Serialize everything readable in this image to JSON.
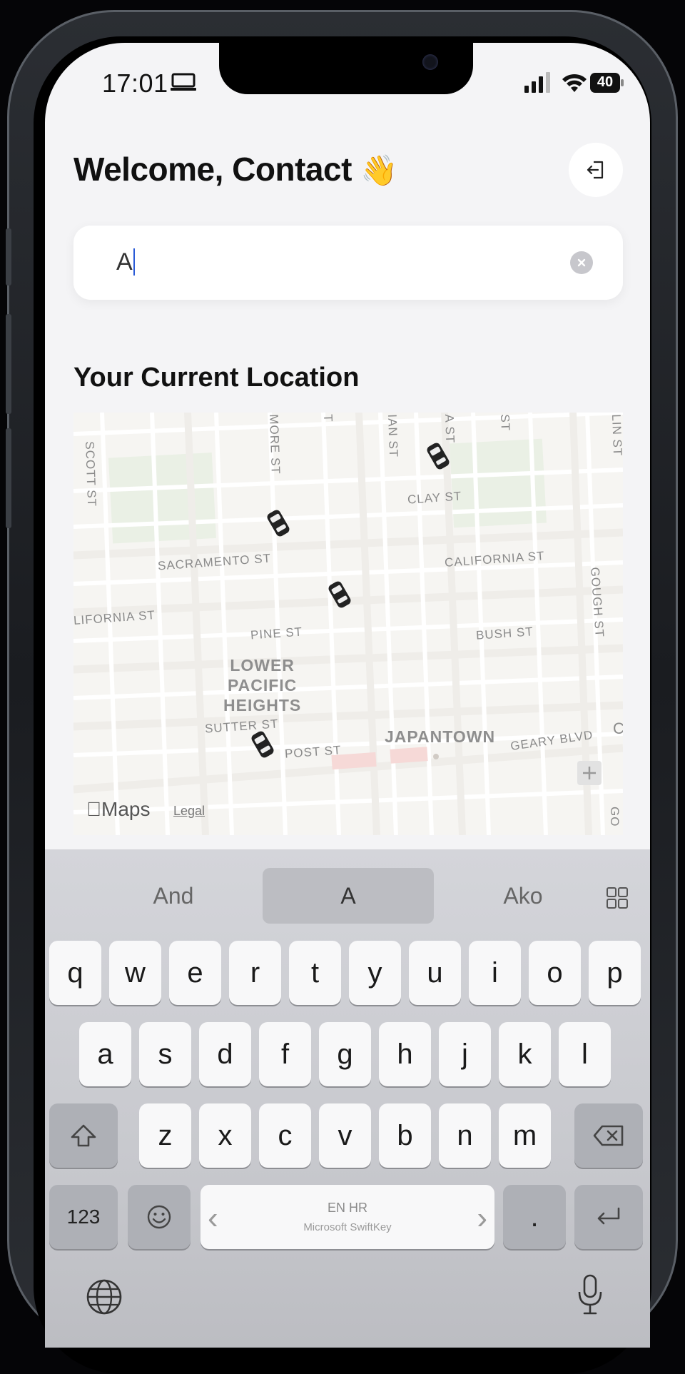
{
  "status_bar": {
    "time": "17:01",
    "battery": "40"
  },
  "header": {
    "welcome": "Welcome, Contact",
    "wave_emoji": "👋"
  },
  "search": {
    "value": "A"
  },
  "location": {
    "title": "Your Current Location",
    "map": {
      "streets": [
        "SCOTT ST",
        "MORE ST",
        "T",
        "IAN ST",
        "A ST",
        "ST",
        "LIN ST",
        "CLAY ST",
        "SACRAMENTO ST",
        "CALIFORNIA ST",
        "LIFORNIA ST",
        "PINE ST",
        "BUSH ST",
        "GOUGH ST",
        "SUTTER ST",
        "POST ST",
        "GEARY BLVD",
        "C",
        "GO"
      ],
      "neighborhoods": [
        "LOWER\nPACIFIC\nHEIGHTS",
        "JAPANTOWN"
      ],
      "attribution": "Maps",
      "legal": "Legal"
    }
  },
  "keyboard": {
    "suggestions": [
      "And",
      "A",
      "Ako"
    ],
    "row1": [
      "q",
      "w",
      "e",
      "r",
      "t",
      "y",
      "u",
      "i",
      "o",
      "p"
    ],
    "row2": [
      "a",
      "s",
      "d",
      "f",
      "g",
      "h",
      "j",
      "k",
      "l"
    ],
    "row3": [
      "z",
      "x",
      "c",
      "v",
      "b",
      "n",
      "m"
    ],
    "numbers_key": "123",
    "space_lang": "EN HR",
    "space_brand": "Microsoft SwiftKey",
    "period_key": "."
  },
  "icons": {
    "device": "laptop-icon",
    "signal": "signal-icon",
    "wifi": "wifi-icon",
    "battery": "battery-icon",
    "logout": "logout-icon",
    "clear": "clear-icon",
    "shift": "shift-icon",
    "backspace": "backspace-icon",
    "emoji": "emoji-icon",
    "return": "return-icon",
    "globe": "globe-icon",
    "mic": "microphone-icon",
    "grid": "grid-icon",
    "car": "car-icon",
    "compass": "compass-icon"
  },
  "colors": {
    "caret": "#2a5bd7",
    "park": "#d6e6cf",
    "poi": "#e99a95",
    "keyboard_bg": "#cfd0d5"
  }
}
